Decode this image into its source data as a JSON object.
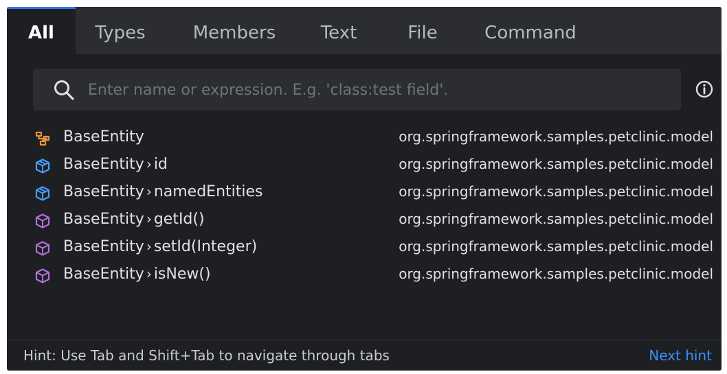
{
  "tabs": [
    {
      "label": "All",
      "active": true
    },
    {
      "label": "Types",
      "active": false
    },
    {
      "label": "Members",
      "active": false
    },
    {
      "label": "Text",
      "active": false
    },
    {
      "label": "File",
      "active": false
    },
    {
      "label": "Command",
      "active": false
    }
  ],
  "search": {
    "value": "",
    "placeholder": "Enter name or expression. E.g. 'class:test field'."
  },
  "results": [
    {
      "icon": "class-icon",
      "owner": "BaseEntity",
      "member": "",
      "package": "org.springframework.samples.petclinic.model"
    },
    {
      "icon": "field-icon",
      "owner": "BaseEntity",
      "member": "id",
      "package": "org.springframework.samples.petclinic.model"
    },
    {
      "icon": "field-icon",
      "owner": "BaseEntity",
      "member": "namedEntities",
      "package": "org.springframework.samples.petclinic.model"
    },
    {
      "icon": "method-icon",
      "owner": "BaseEntity",
      "member": "getId()",
      "package": "org.springframework.samples.petclinic.model"
    },
    {
      "icon": "method-icon",
      "owner": "BaseEntity",
      "member": "setId(Integer)",
      "package": "org.springframework.samples.petclinic.model"
    },
    {
      "icon": "method-icon",
      "owner": "BaseEntity",
      "member": "isNew()",
      "package": "org.springframework.samples.petclinic.model"
    }
  ],
  "footer": {
    "hint": "Hint: Use Tab and Shift+Tab to navigate through tabs",
    "next_hint": "Next hint"
  },
  "colors": {
    "background": "#1e1f22",
    "tabbar": "#2b2d30",
    "accent": "#3574f0",
    "link": "#3592ff",
    "class_icon": "#e8923a",
    "field_icon": "#4a9eff",
    "method_icon": "#b36fdf"
  }
}
